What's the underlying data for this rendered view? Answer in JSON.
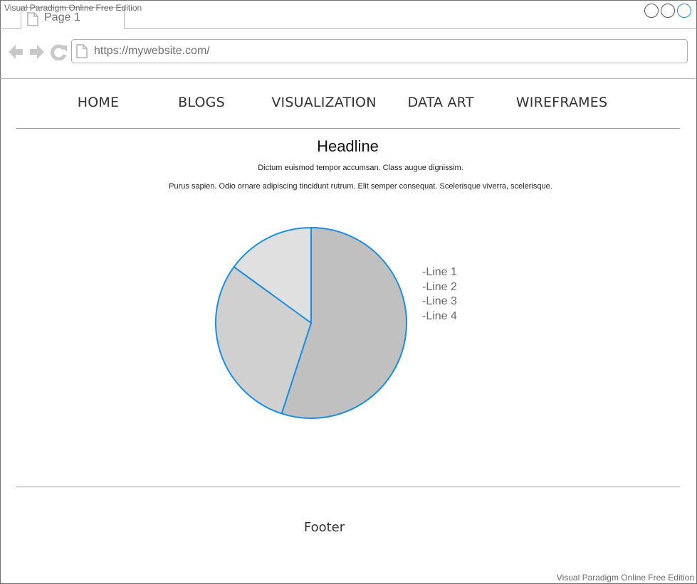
{
  "watermark": "Visual Paradigm Online Free Edition",
  "browser": {
    "tab_label": "Page 1",
    "url": "https://mywebsite.com/"
  },
  "menu": {
    "items": [
      "HOME",
      "BLOGS",
      "VISUALIZATION",
      "DATA ART",
      "WIREFRAMES"
    ]
  },
  "content": {
    "headline": "Headline",
    "line1": "Dictum euismod tempor accumsan. Class augue dignissim.",
    "line2": "Purus sapien. Odio ornare adipiscing tincidunt rutrum.  Elit semper consequat. Scelerisque viverra, scelerisque."
  },
  "chart_data": {
    "type": "pie",
    "values": [
      55,
      30,
      15
    ],
    "colors": [
      "#c0c0c0",
      "#d0d0d0",
      "#e0e0e0"
    ],
    "stroke_color": "#1a8fe0",
    "legend": [
      "-Line 1",
      "-Line 2",
      "-Line 3",
      "-Line 4"
    ]
  },
  "footer": "Footer"
}
